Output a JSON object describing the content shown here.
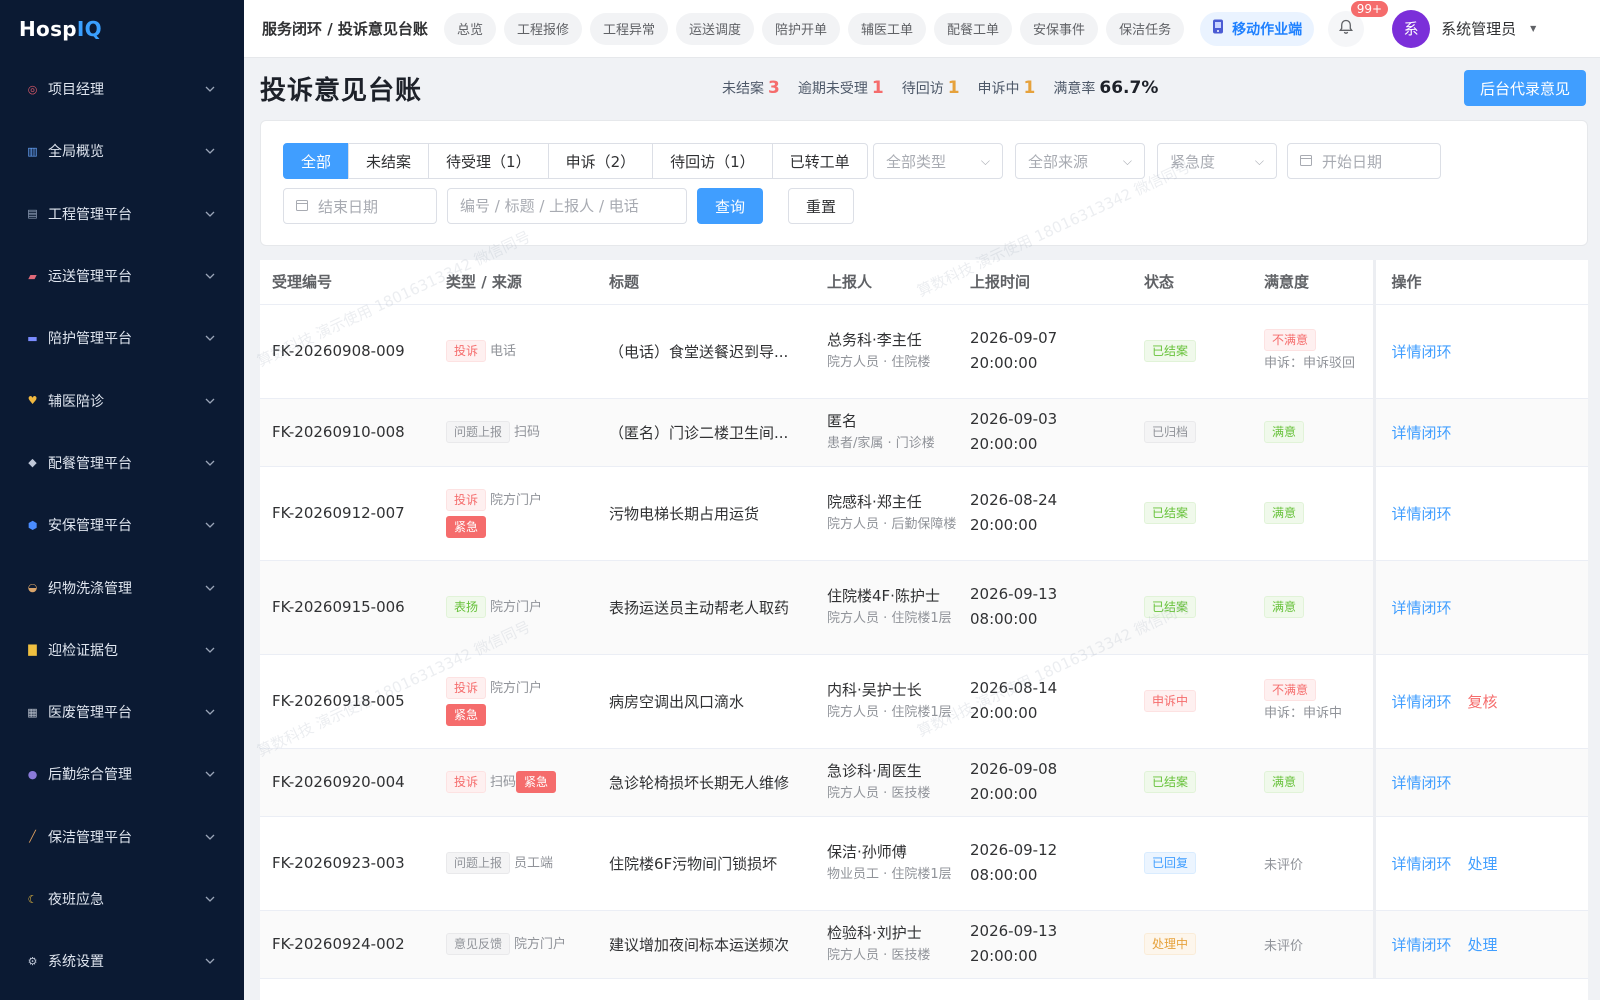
{
  "app": {
    "logo_main": "Hosp",
    "logo_accent": "IQ"
  },
  "sidebar": {
    "items": [
      {
        "label": "项目经理",
        "icon": "target-icon"
      },
      {
        "label": "全局概览",
        "icon": "chart-icon"
      },
      {
        "label": "工程管理平台",
        "icon": "building-icon"
      },
      {
        "label": "运送管理平台",
        "icon": "truck-icon"
      },
      {
        "label": "陪护管理平台",
        "icon": "bed-icon"
      },
      {
        "label": "辅医陪诊",
        "icon": "heart-icon"
      },
      {
        "label": "配餐管理平台",
        "icon": "meal-icon"
      },
      {
        "label": "安保管理平台",
        "icon": "shield-icon"
      },
      {
        "label": "织物洗涤管理",
        "icon": "basket-icon"
      },
      {
        "label": "迎检证据包",
        "icon": "folder-icon"
      },
      {
        "label": "医废管理平台",
        "icon": "bin-icon"
      },
      {
        "label": "后勤综合管理",
        "icon": "people-icon"
      },
      {
        "label": "保洁管理平台",
        "icon": "broom-icon"
      },
      {
        "label": "夜班应急",
        "icon": "moon-icon"
      },
      {
        "label": "系统设置",
        "icon": "gear-icon"
      }
    ]
  },
  "header": {
    "breadcrumb": "服务闭环 / 投诉意见台账",
    "pills": [
      "总览",
      "工程报修",
      "工程异常",
      "运送调度",
      "陪护开单",
      "辅医工单",
      "配餐工单",
      "安保事件",
      "保洁任务"
    ],
    "mobile_label": "移动作业端",
    "badge": "99+",
    "avatar_text": "系",
    "user_name": "系统管理员"
  },
  "page": {
    "title": "投诉意见台账",
    "stats": [
      {
        "label": "未结案",
        "value": "3",
        "color": "red"
      },
      {
        "label": "逾期未受理",
        "value": "1",
        "color": "red"
      },
      {
        "label": "待回访",
        "value": "1",
        "color": "orange"
      },
      {
        "label": "申诉中",
        "value": "1",
        "color": "orange"
      },
      {
        "label": "满意率",
        "value": "66.7%",
        "color": "dark"
      }
    ],
    "add_button": "后台代录意见"
  },
  "filters": {
    "tabs": [
      "全部",
      "未结案",
      "待受理（1）",
      "申诉（2）",
      "待回访（1）",
      "已转工单"
    ],
    "active_tab": 0,
    "type_select": "全部类型",
    "source_select": "全部来源",
    "urgency_select": "紧急度",
    "start_date": "开始日期",
    "end_date": "结束日期",
    "search_placeholder": "编号 / 标题 / 上报人 / 电话",
    "query_button": "查询",
    "reset_button": "重置"
  },
  "table": {
    "columns": [
      "受理编号",
      "类型 / 来源",
      "标题",
      "上报人",
      "上报时间",
      "状态",
      "满意度",
      "操作"
    ],
    "rows": [
      {
        "id": "FK-20260908-009",
        "type": "投诉",
        "type_style": "pink",
        "source": "电话",
        "urgent": "",
        "title": "（电话）食堂送餐迟到导...",
        "reporter": "总务科·李主任",
        "reporter_sub": "院方人员 · 住院楼",
        "date": "2026-09-07",
        "time": "20:00:00",
        "status": "已结案",
        "status_style": "green",
        "sat": "不满意",
        "sat_style": "pink",
        "sat_note": "申诉：申诉驳回",
        "ops": [
          "详情闭环"
        ]
      },
      {
        "id": "FK-20260910-008",
        "type": "问题上报",
        "type_style": "gray",
        "source": "扫码",
        "urgent": "",
        "title": "（匿名）门诊二楼卫生间...",
        "reporter": "匿名",
        "reporter_sub": "患者/家属 · 门诊楼",
        "date": "2026-09-03",
        "time": "20:00:00",
        "status": "已归档",
        "status_style": "gray",
        "sat": "满意",
        "sat_style": "green",
        "sat_note": "",
        "ops": [
          "详情闭环"
        ]
      },
      {
        "id": "FK-20260912-007",
        "type": "投诉",
        "type_style": "pink",
        "source": "院方门户",
        "urgent": "紧急",
        "title": "污物电梯长期占用运货",
        "reporter": "院感科·郑主任",
        "reporter_sub": "院方人员 · 后勤保障楼",
        "date": "2026-08-24",
        "time": "20:00:00",
        "status": "已结案",
        "status_style": "green",
        "sat": "满意",
        "sat_style": "green",
        "sat_note": "",
        "ops": [
          "详情闭环"
        ]
      },
      {
        "id": "FK-20260915-006",
        "type": "表扬",
        "type_style": "green",
        "source": "院方门户",
        "urgent": "",
        "title": "表扬运送员主动帮老人取药",
        "reporter": "住院楼4F·陈护士",
        "reporter_sub": "院方人员 · 住院楼1层",
        "date": "2026-09-13",
        "time": "08:00:00",
        "status": "已结案",
        "status_style": "green",
        "sat": "满意",
        "sat_style": "green",
        "sat_note": "",
        "ops": [
          "详情闭环"
        ]
      },
      {
        "id": "FK-20260918-005",
        "type": "投诉",
        "type_style": "pink",
        "source": "院方门户",
        "urgent": "紧急",
        "title": "病房空调出风口滴水",
        "reporter": "内科·吴护士长",
        "reporter_sub": "院方人员 · 住院楼1层",
        "date": "2026-08-14",
        "time": "20:00:00",
        "status": "申诉中",
        "status_style": "pink",
        "sat": "不满意",
        "sat_style": "pink",
        "sat_note": "申诉：申诉中",
        "ops": [
          "详情闭环",
          "复核"
        ]
      },
      {
        "id": "FK-20260920-004",
        "type": "投诉",
        "type_style": "pink",
        "source": "扫码",
        "urgent": "紧急",
        "urgent_inline": true,
        "title": "急诊轮椅损坏长期无人维修",
        "reporter": "急诊科·周医生",
        "reporter_sub": "院方人员 · 医技楼",
        "date": "2026-09-08",
        "time": "20:00:00",
        "status": "已结案",
        "status_style": "green",
        "sat": "满意",
        "sat_style": "green",
        "sat_note": "",
        "ops": [
          "详情闭环"
        ]
      },
      {
        "id": "FK-20260923-003",
        "type": "问题上报",
        "type_style": "gray",
        "source": "员工端",
        "urgent": "",
        "title": "住院楼6F污物间门锁损坏",
        "reporter": "保洁·孙师傅",
        "reporter_sub": "物业员工 · 住院楼1层",
        "date": "2026-09-12",
        "time": "08:00:00",
        "status": "已回复",
        "status_style": "blue",
        "sat": "未评价",
        "sat_style": "plain",
        "sat_note": "",
        "ops": [
          "详情闭环",
          "处理"
        ]
      },
      {
        "id": "FK-20260924-002",
        "type": "意见反馈",
        "type_style": "gray",
        "source": "院方门户",
        "urgent": "",
        "title": "建议增加夜间标本运送频次",
        "reporter": "检验科·刘护士",
        "reporter_sub": "院方人员 · 医技楼",
        "date": "2026-09-13",
        "time": "20:00:00",
        "status": "处理中",
        "status_style": "orange",
        "sat": "未评价",
        "sat_style": "plain",
        "sat_note": "",
        "ops": [
          "详情闭环",
          "处理"
        ]
      }
    ]
  },
  "colors": {
    "sidebar_bg": "#0b1a33",
    "primary": "#409eff",
    "danger": "#f56c6c",
    "warning": "#e6a23c",
    "success": "#67c23a",
    "avatar": "#7b2fd9"
  }
}
